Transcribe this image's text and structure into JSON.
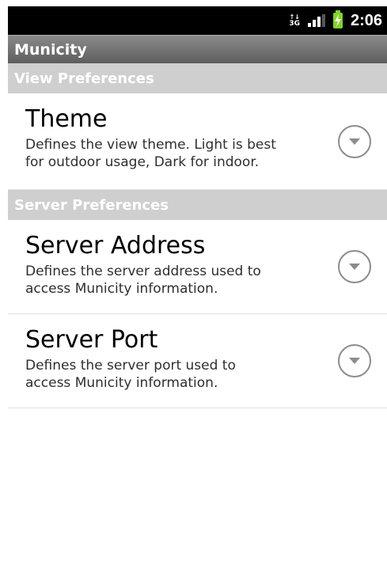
{
  "status_bar": {
    "network_type": "3G",
    "time": "2:06",
    "signal_icon": "signal-bars-icon",
    "battery_icon": "battery-charging-icon",
    "battery_color": "#7fd620"
  },
  "app": {
    "title": "Municity"
  },
  "categories": [
    {
      "label": "View Preferences",
      "items": [
        {
          "title": "Theme",
          "summary_line1": "Defines the view theme. Light is best",
          "summary_line2": "for outdoor usage, Dark for indoor."
        }
      ]
    },
    {
      "label": "Server Preferences",
      "items": [
        {
          "title": "Server Address",
          "summary_line1": "Defines the server address used to",
          "summary_line2": "access Municity information."
        },
        {
          "title": "Server Port",
          "summary_line1": "Defines the server port used to",
          "summary_line2": "access Municity information."
        }
      ]
    }
  ]
}
